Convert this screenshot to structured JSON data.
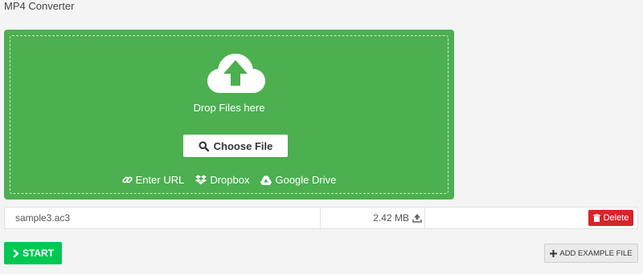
{
  "app": {
    "title": "MP4 Converter"
  },
  "dropzone": {
    "drop_text": "Drop Files here",
    "choose_label": "Choose File",
    "sources": [
      {
        "label": "Enter URL",
        "icon": "link-icon"
      },
      {
        "label": "Dropbox",
        "icon": "dropbox-icon"
      },
      {
        "label": "Google Drive",
        "icon": "google-drive-icon"
      }
    ],
    "colors": {
      "background": "#4caf50"
    }
  },
  "files": [
    {
      "name": "sample3.ac3",
      "size": "2.42 MB",
      "delete_label": "Delete"
    }
  ],
  "actions": {
    "start_label": "START",
    "add_example_label": "ADD EXAMPLE FILE"
  },
  "colors": {
    "start": "#00c853",
    "delete": "#d9232b"
  }
}
